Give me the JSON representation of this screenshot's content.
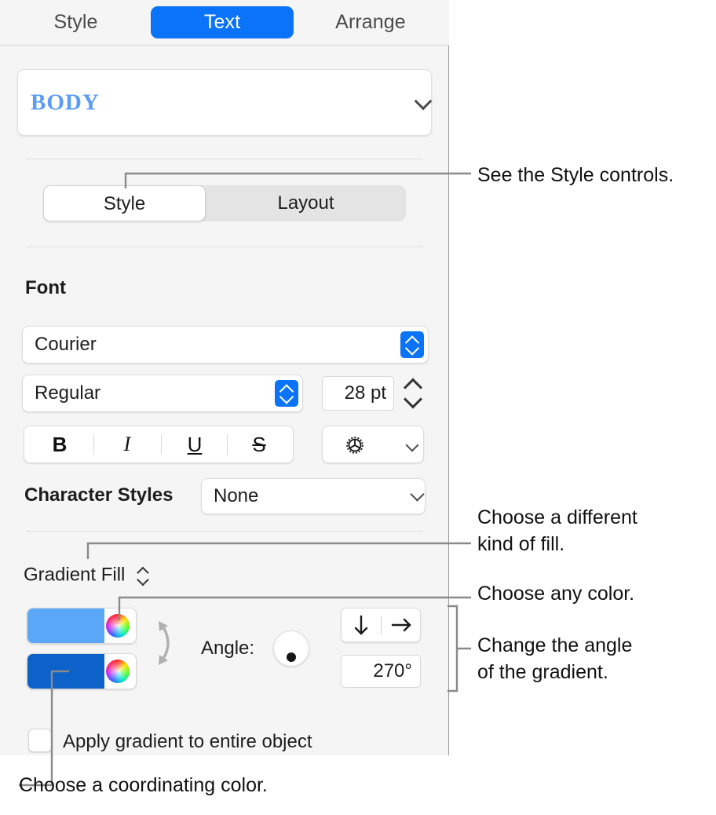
{
  "panel": {
    "tabs": [
      {
        "label": "Style",
        "selected": false
      },
      {
        "label": "Text",
        "selected": true
      },
      {
        "label": "Arrange",
        "selected": false
      }
    ],
    "paragraph_style": {
      "value": "BODY",
      "chevron_icon": "chevron-down-icon",
      "text_color": "#5b9cf6"
    },
    "segmented": {
      "options": [
        "Style",
        "Layout"
      ],
      "selected": "Style"
    },
    "font_section": {
      "heading": "Font",
      "family": "Courier",
      "style": "Regular",
      "size": "28 pt",
      "format_buttons": [
        {
          "name": "bold-button",
          "label": "B"
        },
        {
          "name": "italic-button",
          "label": "I"
        },
        {
          "name": "underline-button",
          "label": "U"
        },
        {
          "name": "strikethrough-button",
          "label": "S"
        }
      ],
      "advanced_options_icon": "gear-icon"
    },
    "character_styles": {
      "label": "Character Styles",
      "value": "None"
    },
    "fill": {
      "kind": "Gradient Fill",
      "stops": [
        {
          "name": "gradient-color-start",
          "color": "#5aa7f8"
        },
        {
          "name": "gradient-color-end",
          "color": "#0d62c9"
        }
      ],
      "swap_icon": "swap-colors-icon",
      "angle_label": "Angle:",
      "angle_value": "270°",
      "direction_buttons": [
        {
          "name": "gradient-direction-down-button",
          "icon": "arrow-down-icon"
        },
        {
          "name": "gradient-direction-right-button",
          "icon": "arrow-right-icon"
        }
      ],
      "apply_entire_object": {
        "label": "Apply gradient to entire object",
        "checked": false
      }
    }
  },
  "callouts": {
    "style_controls": "See the Style controls.",
    "different_fill": "Choose a different\nkind of fill.",
    "any_color": "Choose any color.",
    "change_angle": "Change the angle\nof the gradient.",
    "coordinating_color": "Choose a coordinating color."
  }
}
